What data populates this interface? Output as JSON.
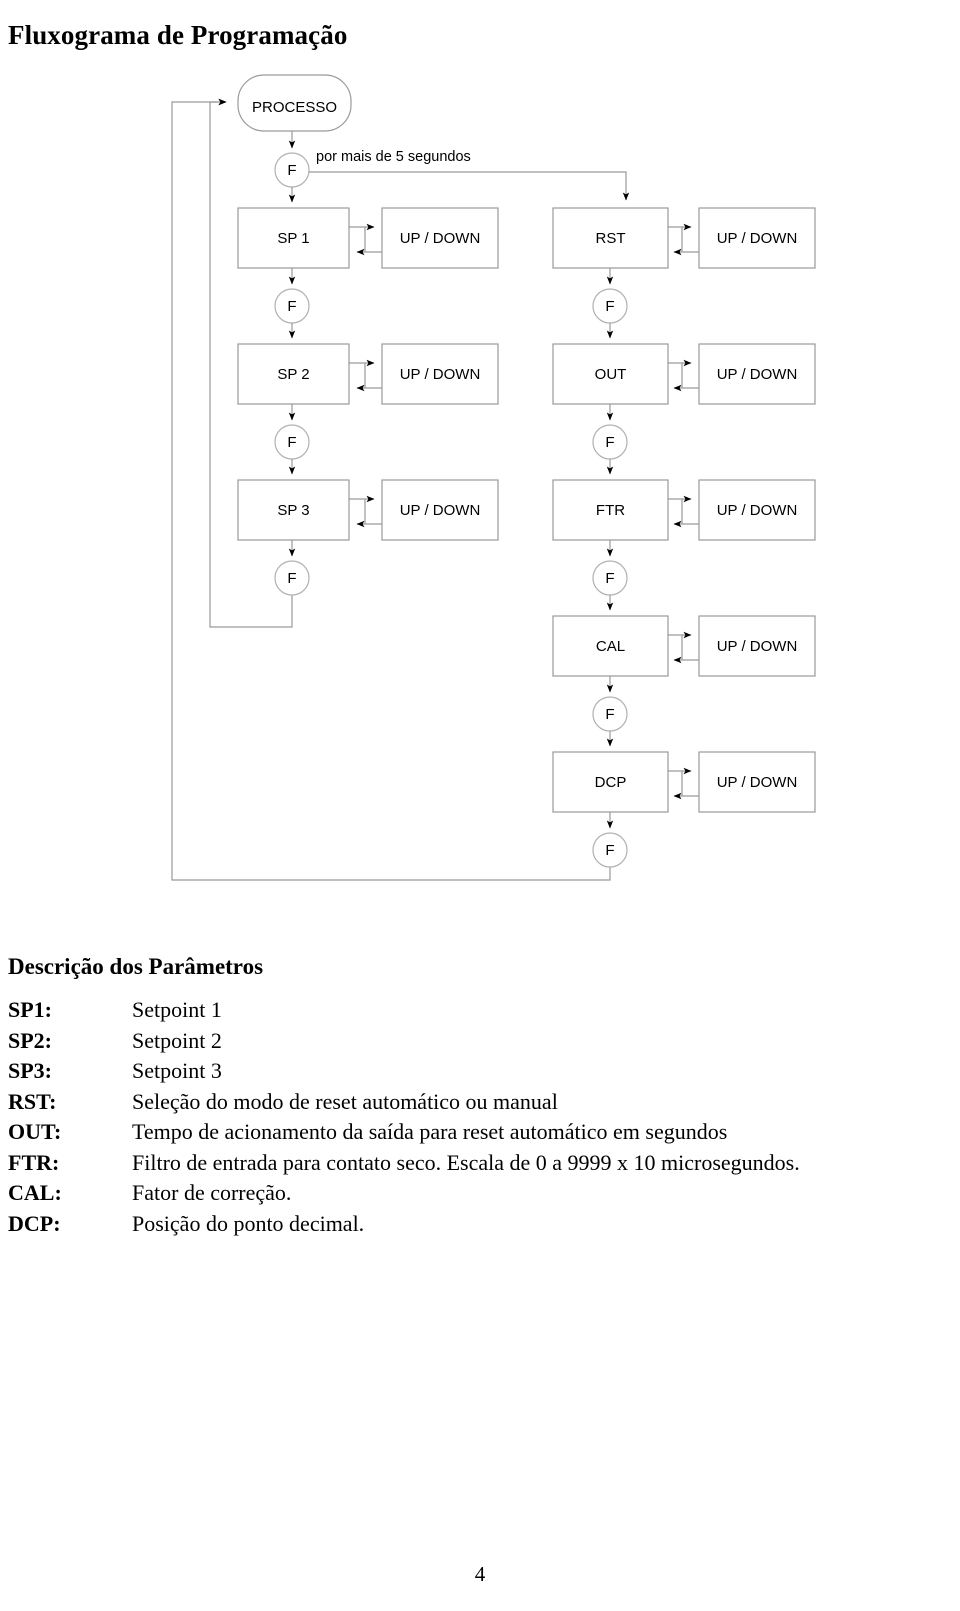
{
  "document": {
    "title": "Fluxograma de Programação",
    "section_heading": "Descrição dos Parâmetros",
    "page_number": "4"
  },
  "flowchart": {
    "start_node": "PROCESSO",
    "edge_label": "por mais de 5 segundos",
    "key_label": "F",
    "adjust_label": "UP / DOWN",
    "nodes": [
      {
        "id": "sp1",
        "label": "SP 1",
        "column": "left",
        "row": 1
      },
      {
        "id": "sp2",
        "label": "SP 2",
        "column": "left",
        "row": 2
      },
      {
        "id": "sp3",
        "label": "SP 3",
        "column": "left",
        "row": 3
      },
      {
        "id": "rst",
        "label": "RST",
        "column": "right",
        "row": 1
      },
      {
        "id": "out",
        "label": "OUT",
        "column": "right",
        "row": 2
      },
      {
        "id": "ftr",
        "label": "FTR",
        "column": "right",
        "row": 3
      },
      {
        "id": "cal",
        "label": "CAL",
        "column": "right",
        "row": 4
      },
      {
        "id": "dcp",
        "label": "DCP",
        "column": "right",
        "row": 5
      }
    ],
    "updown_labels": [
      "UP / DOWN",
      "UP / DOWN",
      "UP / DOWN",
      "UP / DOWN",
      "UP / DOWN",
      "UP / DOWN",
      "UP / DOWN",
      "UP / DOWN"
    ],
    "f_circles": [
      "F",
      "F",
      "F",
      "F",
      "F",
      "F",
      "F",
      "F",
      "F"
    ]
  },
  "parameters": [
    {
      "key": "SP1:",
      "desc": "Setpoint 1"
    },
    {
      "key": "SP2:",
      "desc": "Setpoint 2"
    },
    {
      "key": "SP3:",
      "desc": "Setpoint 3"
    },
    {
      "key": "RST:",
      "desc": "Seleção do modo de reset automático ou manual"
    },
    {
      "key": "OUT:",
      "desc": "Tempo de acionamento da saída para reset automático em segundos"
    },
    {
      "key": "FTR:",
      "desc": "Filtro de entrada para contato seco. Escala de 0 a 9999 x 10 microsegundos."
    },
    {
      "key": "CAL:",
      "desc": "Fator de correção."
    },
    {
      "key": "DCP:",
      "desc": "Posição do ponto decimal."
    }
  ]
}
